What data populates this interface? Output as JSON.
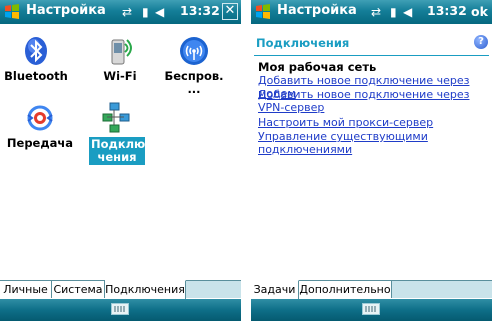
{
  "left": {
    "titlebar": {
      "title": "Настройка",
      "clock": "13:32",
      "close_label": "✕"
    },
    "icons": [
      {
        "label": "Bluetooth",
        "icon": "bluetooth-icon"
      },
      {
        "label": "Wi-Fi",
        "icon": "wifi-icon"
      },
      {
        "label": "Беспров. ...",
        "icon": "wireless-icon"
      },
      {
        "label": "Передача",
        "icon": "beam-icon"
      },
      {
        "label": "Подклю-\nчения",
        "icon": "connections-icon",
        "selected": true
      }
    ],
    "tabs": [
      {
        "label": "Личные"
      },
      {
        "label": "Система"
      },
      {
        "label": "Подключения",
        "active": true
      }
    ]
  },
  "right": {
    "titlebar": {
      "title": "Настройка",
      "clock": "13:32",
      "ok_label": "ok"
    },
    "page_title": "Подключения",
    "help_label": "?",
    "network_heading": "Моя рабочая сеть",
    "links": [
      "Добавить новое подключение через модем",
      "Добавить новое подключение через VPN-сервер",
      "Настроить мой прокси-сервер",
      "Управление существующими подключениями"
    ],
    "tabs": [
      {
        "label": "Задачи",
        "active": true
      },
      {
        "label": "Дополнительно"
      }
    ]
  },
  "colors": {
    "accent": "#1a9dc2",
    "titlebar": "#147e98",
    "link": "#1f3cc8"
  }
}
